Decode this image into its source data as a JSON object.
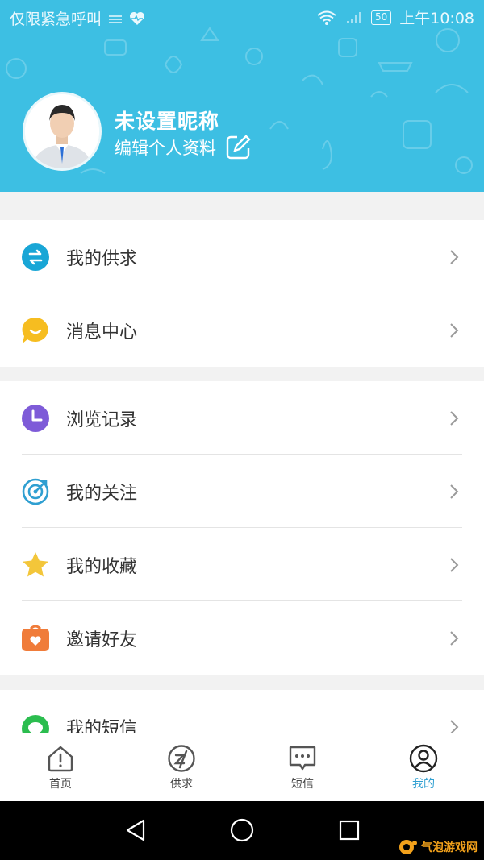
{
  "status_bar": {
    "carrier": "仅限紧急呼叫",
    "battery": "50",
    "time": "上午10:08"
  },
  "profile": {
    "nickname": "未设置昵称",
    "edit_label": "编辑个人资料"
  },
  "menu": {
    "group1": [
      {
        "label": "我的供求",
        "icon": "swap-icon",
        "color": "#19a6d6"
      },
      {
        "label": "消息中心",
        "icon": "chat-bubble-icon",
        "color": "#f6bd20"
      }
    ],
    "group2": [
      {
        "label": "浏览记录",
        "icon": "clock-icon",
        "color": "#7e5bd8"
      },
      {
        "label": "我的关注",
        "icon": "target-icon",
        "color": "#2f9fd1"
      },
      {
        "label": "我的收藏",
        "icon": "star-icon",
        "color": "#f3c63a"
      },
      {
        "label": "邀请好友",
        "icon": "gift-icon",
        "color": "#f07c3a"
      }
    ],
    "group3": [
      {
        "label": "我的短信",
        "icon": "message-icon",
        "color": "#2bbd4f"
      }
    ]
  },
  "bottom_nav": {
    "tabs": [
      {
        "label": "首页",
        "icon": "home-icon"
      },
      {
        "label": "供求",
        "icon": "supply-icon"
      },
      {
        "label": "短信",
        "icon": "sms-icon"
      },
      {
        "label": "我的",
        "icon": "profile-icon",
        "active": true
      }
    ]
  },
  "watermark": {
    "text": "气泡游戏网"
  },
  "colors": {
    "header": "#3dbfe3",
    "active_tab": "#2f9fd1"
  }
}
